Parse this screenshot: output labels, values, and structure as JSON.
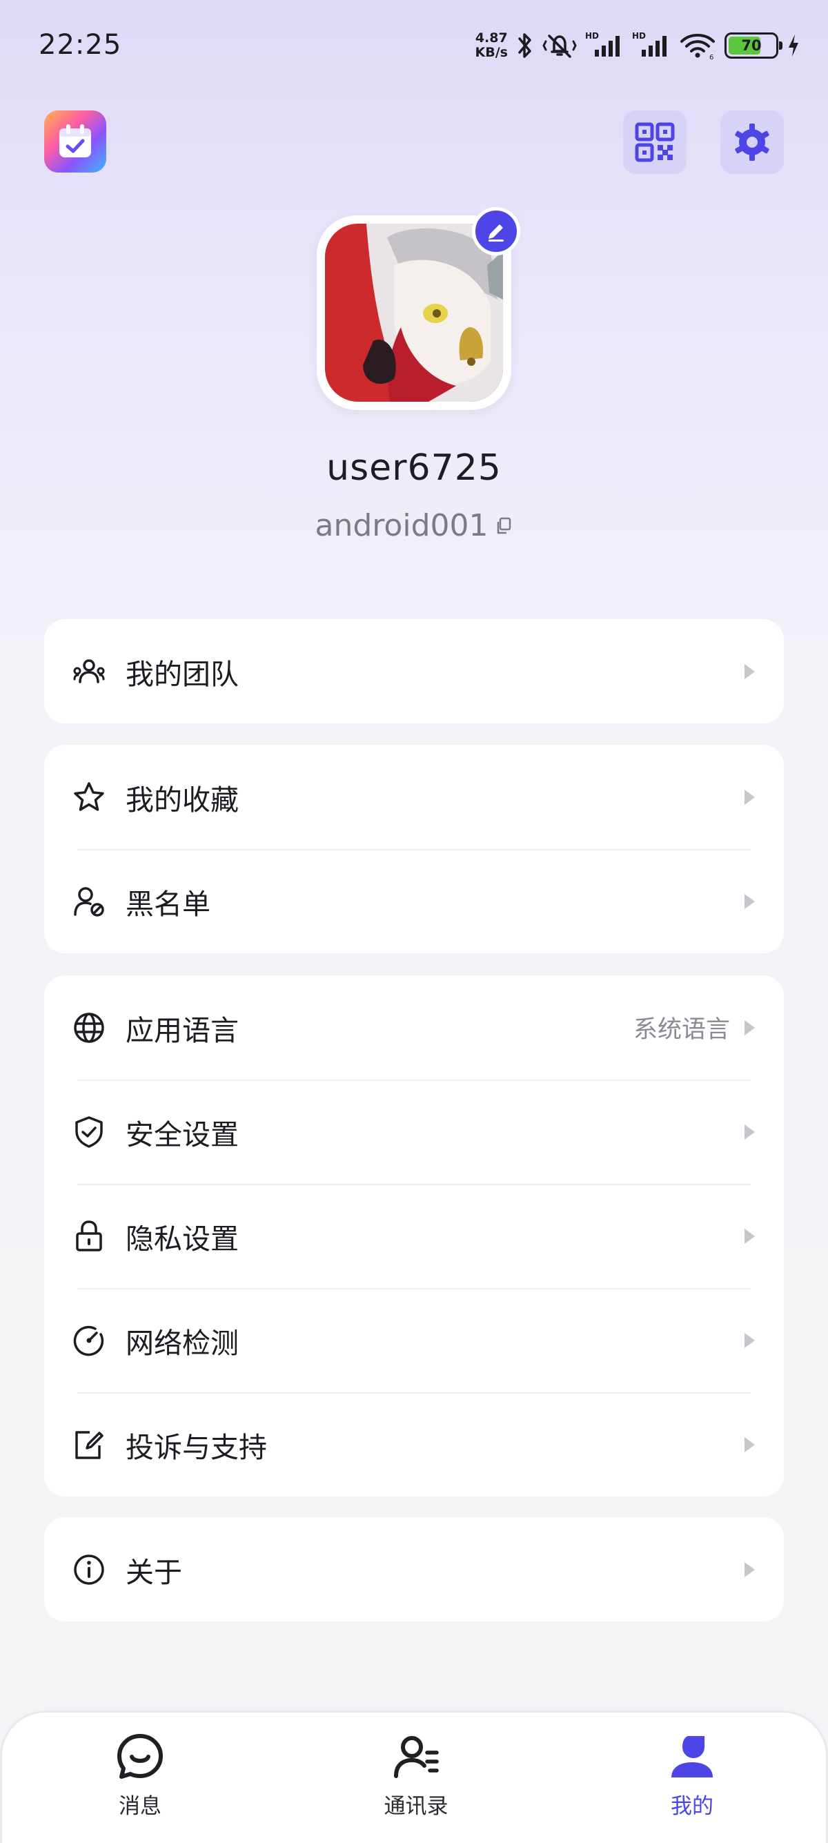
{
  "status_bar": {
    "time": "22:25",
    "net_speed_value": "4.87",
    "net_speed_unit": "KB/s",
    "battery_level": "70",
    "battery_fraction": 0.7,
    "icons": [
      "bluetooth-icon",
      "mute-vibrate-icon",
      "signal-hd-icon",
      "signal-hd-icon",
      "wifi-icon",
      "battery-icon",
      "charging-icon"
    ]
  },
  "header": {
    "left_icon": "calendar-check-icon",
    "right_icons": [
      "qr-code-icon",
      "gear-icon"
    ]
  },
  "profile": {
    "username": "user6725",
    "account_id": "android001",
    "edit_icon": "pencil-icon",
    "copy_icon": "copy-icon"
  },
  "menu": {
    "team": {
      "label": "我的团队",
      "icon": "team-icon"
    },
    "favorites": {
      "label": "我的收藏",
      "icon": "star-icon"
    },
    "blacklist": {
      "label": "黑名单",
      "icon": "user-block-icon"
    },
    "language": {
      "label": "应用语言",
      "value": "系统语言",
      "icon": "globe-icon"
    },
    "security": {
      "label": "安全设置",
      "icon": "shield-check-icon"
    },
    "privacy": {
      "label": "隐私设置",
      "icon": "lock-icon"
    },
    "network": {
      "label": "网络检测",
      "icon": "gauge-icon"
    },
    "complaint": {
      "label": "投诉与支持",
      "icon": "edit-note-icon"
    },
    "about": {
      "label": "关于",
      "icon": "info-icon"
    }
  },
  "bottom_nav": {
    "items": [
      {
        "label": "消息",
        "icon": "chat-smile-icon",
        "active": false
      },
      {
        "label": "通讯录",
        "icon": "contacts-icon",
        "active": false
      },
      {
        "label": "我的",
        "icon": "person-icon",
        "active": true
      }
    ]
  },
  "colors": {
    "accent": "#4d45e6",
    "background_top": "#ddd9f8",
    "background": "#f4f4f7",
    "card": "#ffffff",
    "text_primary": "#1c1c22",
    "text_secondary": "#8a8a92"
  }
}
